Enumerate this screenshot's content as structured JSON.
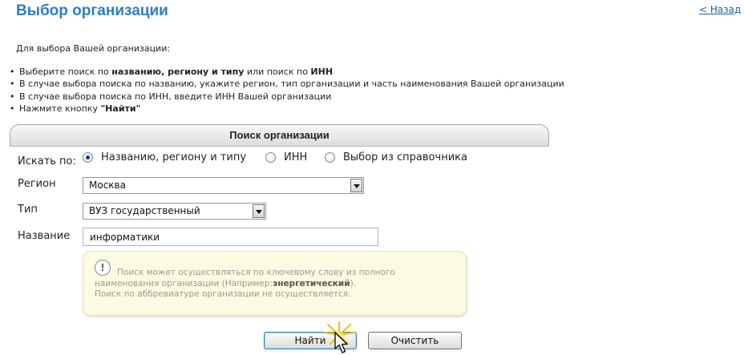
{
  "page": {
    "title": "Выбор организации",
    "back_link": "< Назад"
  },
  "intro": "Для выбора Вашей организации:",
  "instructions": [
    {
      "before": "Выберите поиск по ",
      "bold1": "названию, региону и типу",
      "mid": " или поиск по ",
      "bold2": "ИНН"
    },
    {
      "text": "В случае выбора поиска по названию, укажите регион, тип организации и часть наименования Вашей организации"
    },
    {
      "text": "В случае выбора поиска по ИНН, введите ИНН Вашей организации"
    },
    {
      "before": "Нажмите кнопку ",
      "bold1": "\"Найти\""
    }
  ],
  "panel": {
    "title": "Поиск организации"
  },
  "form": {
    "search_by_label": "Искать по:",
    "search_options": [
      {
        "label": "Названию, региону и типу",
        "checked": true
      },
      {
        "label": "ИНН",
        "checked": false
      },
      {
        "label": "Выбор из справочника",
        "checked": false
      }
    ],
    "region_label": "Регион",
    "region_value": "Москва",
    "type_label": "Тип",
    "type_value": "ВУЗ государственный",
    "name_label": "Название",
    "name_value": "информатики"
  },
  "hint": {
    "icon_glyph": "!",
    "line1": "Поиск может осуществляться по ключевому слову из полного",
    "line2_before": "наименования организации (Например:",
    "line2_bold": "энергетический",
    "line2_after": ").",
    "line3": "Поиск по аббревиатуре организации не осуществляется."
  },
  "buttons": {
    "find": "Найти",
    "clear": "Очистить"
  },
  "colors": {
    "title": "#2a7fc6",
    "link": "#1a5fa8",
    "hint_bg": "#fcfae0",
    "sparkle": "#f5c400"
  }
}
